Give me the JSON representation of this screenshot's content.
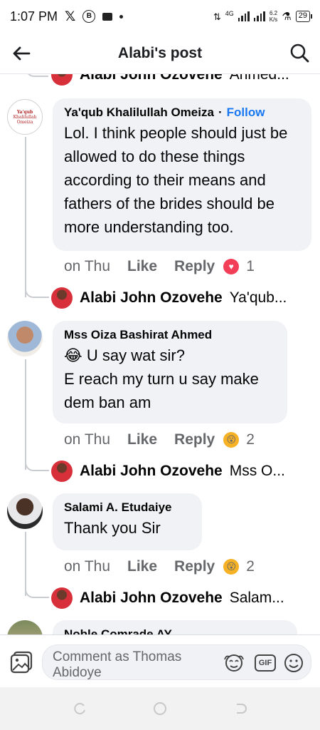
{
  "status": {
    "time": "1:07 PM",
    "network": "4G",
    "speed_top": "6.2",
    "speed_bottom": "K/s",
    "battery": "29"
  },
  "header": {
    "title": "Alabi's post"
  },
  "thread": {
    "top_reply": {
      "name": "Alabi John Ozovehe",
      "snippet": "Ahmed..."
    },
    "comments": [
      {
        "name": "Ya'qub Khalilullah Omeiza",
        "follow_label": "Follow",
        "separator": "·",
        "avatar_text": [
          "Ya'qub",
          "Khalilullah",
          "Omeiza"
        ],
        "text": "Lol. I think people should just be allowed to do these things according to their means and fathers of the brides should be more understanding too.",
        "time": "on Thu",
        "like": "Like",
        "reply": "Reply",
        "reaction": "love",
        "reaction_count": "1",
        "reply_preview": {
          "name": "Alabi John Ozovehe",
          "snippet": "Ya'qub..."
        }
      },
      {
        "name": "Mss Oiza Bashirat Ahmed",
        "emoji": "😂",
        "text_line1": "U say wat sir?",
        "text_rest": "E reach my turn u say make dem ban am",
        "time": "on Thu",
        "like": "Like",
        "reply": "Reply",
        "reaction": "haha",
        "reaction_count": "2",
        "reply_preview": {
          "name": "Alabi John Ozovehe",
          "snippet": "Mss O..."
        }
      },
      {
        "name": "Salami A. Etudaiye",
        "text": "Thank you Sir",
        "time": "on Thu",
        "like": "Like",
        "reply": "Reply",
        "reaction": "haha",
        "reaction_count": "2",
        "reply_preview": {
          "name": "Alabi John Ozovehe",
          "snippet": "Salam..."
        }
      },
      {
        "name": "Noble Comrade AY"
      }
    ]
  },
  "composer": {
    "placeholder": "Comment as Thomas Abidoye",
    "gif_label": "GIF"
  },
  "colors": {
    "link": "#1877f2",
    "bubble": "#f0f2f5",
    "meta": "#65676b",
    "love": "#f33e58",
    "haha": "#f7b125"
  }
}
